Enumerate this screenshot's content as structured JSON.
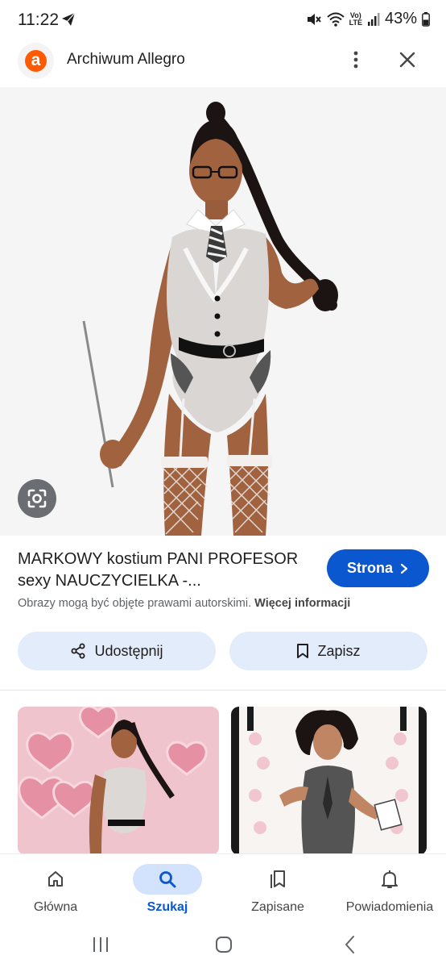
{
  "status_bar": {
    "time": "11:22",
    "battery": "43%",
    "icons": [
      "telegram-icon",
      "mute-icon",
      "wifi-icon",
      "volte-icon",
      "signal-icon",
      "battery-icon"
    ],
    "volte_top": "Vo)",
    "volte_bottom": "LTE"
  },
  "header": {
    "logo_letter": "a",
    "title": "Archiwum Allegro",
    "brand_color": "#ff5a00"
  },
  "result": {
    "title": "MARKOWY kostium PANI PROFESOR sexy NAUCZYCIELKA -...",
    "visit_label": "Strona",
    "copyright_text": "Obrazy mogą być objęte prawami autorskimi.",
    "more_info_link": "Więcej informacji",
    "share_label": "Udostępnij",
    "save_label": "Zapisz"
  },
  "bottom_nav": {
    "items": [
      {
        "label": "Główna",
        "icon": "home-icon",
        "active": false
      },
      {
        "label": "Szukaj",
        "icon": "search-icon",
        "active": true
      },
      {
        "label": "Zapisane",
        "icon": "bookmarks-icon",
        "active": false
      },
      {
        "label": "Powiadomienia",
        "icon": "bell-icon",
        "active": false
      }
    ]
  },
  "colors": {
    "accent": "#0b57d0",
    "chip_bg": "#e3ecfa",
    "active_nav_bg": "#d3e3fd"
  }
}
